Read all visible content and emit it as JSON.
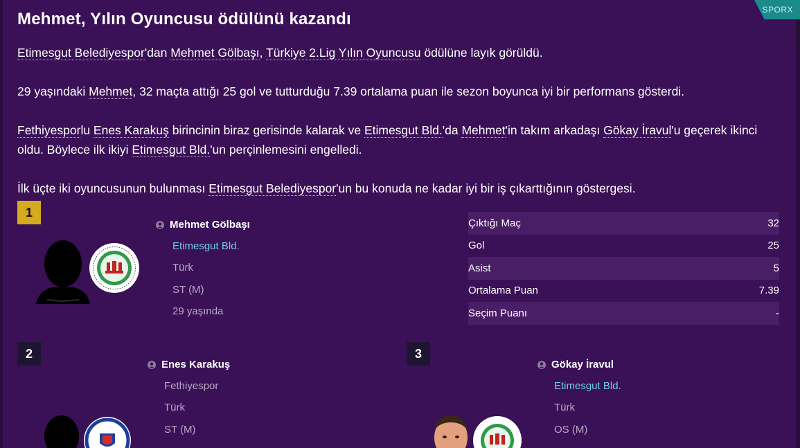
{
  "source_tag": "SPORX",
  "title": "Mehmet, Yılın Oyuncusu ödülünü kazandı",
  "paragraphs": {
    "p1": {
      "club": "Etimesgut Belediyespor",
      "t1": "'dan ",
      "player": "Mehmet Gölbaşı",
      "t2": ", ",
      "award": "Türkiye 2.Lig Yılın Oyuncusu",
      "t3": " ödülüne layık görüldü."
    },
    "p2": {
      "t1": "29 yaşındaki ",
      "player": "Mehmet",
      "t2": ", 32 maçta attığı 25 gol ve tutturduğu 7.39 ortalama puan ile sezon boyunca iyi bir performans gösterdi."
    },
    "p3": {
      "club1": "Fethiyespor",
      "t1": "lu ",
      "player1": "Enes Karakuş",
      "t2": " birincinin biraz gerisinde kalarak ve ",
      "club2": "Etimesgut Bld.",
      "t3": "'da ",
      "player2": "Mehmet",
      "t4": "'in takım arkadaşı ",
      "player3": "Gökay İravul",
      "t5": "'u geçerek ikinci oldu. Böylece ilk ikiyi ",
      "club3": "Etimesgut Bld.",
      "t6": "'un perçinlemesini engelledi."
    },
    "p4": {
      "t1": "İlk üçte iki oyuncusunun bulunması ",
      "club": "Etimesgut Belediyespor",
      "t2": "'un bu konuda ne kadar iyi bir iş çıkarttığının göstergesi."
    }
  },
  "winners": [
    {
      "rank": "1",
      "name": "Mehmet Gölbaşı",
      "club": "Etimesgut Bld.",
      "nationality": "Türk",
      "position": "ST (M)",
      "age": "29 yaşında"
    },
    {
      "rank": "2",
      "name": "Enes Karakuş",
      "club": "Fethiyespor",
      "nationality": "Türk",
      "position": "ST (M)"
    },
    {
      "rank": "3",
      "name": "Gökay İravul",
      "club": "Etimesgut Bld.",
      "nationality": "Türk",
      "position": "OS (M)"
    }
  ],
  "stats": [
    {
      "label": "Çıktığı Maç",
      "value": "32"
    },
    {
      "label": "Gol",
      "value": "25"
    },
    {
      "label": "Asist",
      "value": "5"
    },
    {
      "label": "Ortalama Puan",
      "value": "7.39"
    },
    {
      "label": "Seçim Puanı",
      "value": "-"
    }
  ],
  "colors": {
    "background": "#3a1056",
    "gold_rank": "#d4ab1e",
    "club_link": "#6fcde8",
    "tag": "#1b8a8a"
  },
  "icons": {
    "person": "person-icon",
    "club_badge_etimesgut": "etimesgut-badge-icon",
    "club_badge_fethiyespor": "fethiyespor-badge-icon"
  }
}
